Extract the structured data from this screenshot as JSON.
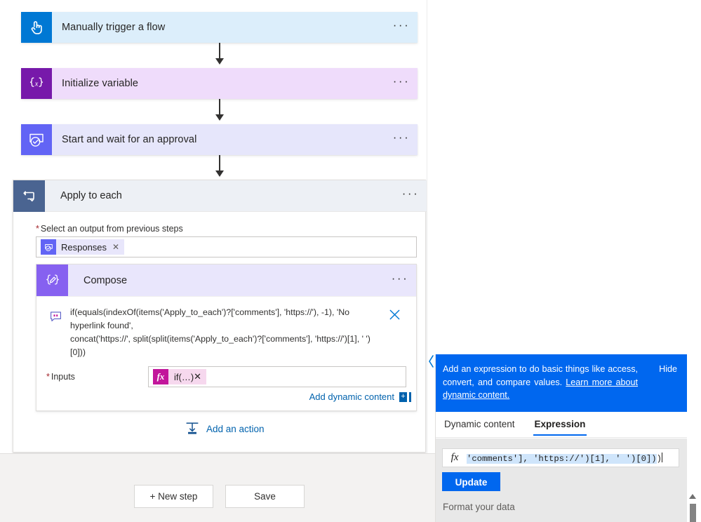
{
  "canvas": {
    "cards": [
      {
        "id": "trigger",
        "title": "Manually trigger a flow",
        "icon": "touch-tap-icon",
        "menu": "···"
      },
      {
        "id": "initvar",
        "title": "Initialize variable",
        "icon": "variable-braces-icon",
        "menu": "···"
      },
      {
        "id": "approval",
        "title": "Start and wait for an approval",
        "icon": "approval-check-icon",
        "menu": "···"
      }
    ],
    "scope": {
      "title": "Apply to each",
      "icon": "loop-repeat-icon",
      "menu": "···",
      "select_output_label": "Select an output from previous steps",
      "required_marker": "*",
      "output_token": {
        "label": "Responses",
        "icon": "approval-check-icon",
        "remove": "✕"
      },
      "compose": {
        "title": "Compose",
        "icon": "compose-pencil-icon",
        "menu": "···",
        "expression_line_1": "if(equals(indexOf(items('Apply_to_each')?['comments'], 'https://'), -1), 'No hyperlink found',",
        "expression_line_2": "concat('https://', split(split(items('Apply_to_each')?['comments'], 'https://')[1], ' ')[0]))",
        "expression_icon": "comment-bubble-icon",
        "expression_close_icon": "close-x-icon",
        "inputs_label": "Inputs",
        "inputs_token": {
          "fx": "fx",
          "label": "if(…)",
          "remove": "✕"
        },
        "add_dynamic_content": "Add dynamic content",
        "add_dynamic_plus": "+"
      }
    },
    "add_action": {
      "label": "Add an action",
      "icon": "add-action-icon"
    },
    "bottom_buttons": {
      "new_step": "+ New step",
      "save": "Save"
    }
  },
  "expression_panel": {
    "banner": {
      "text_before_link": "Add an expression to do basic things like access, convert, and compare values. ",
      "link_text": "Learn more about dynamic content.",
      "hide_label": "Hide"
    },
    "tabs": [
      {
        "label": "Dynamic content",
        "active": false
      },
      {
        "label": "Expression",
        "active": true
      }
    ],
    "editor": {
      "fx_glyph": "fx",
      "selected_text": "'comments'], 'https://')[1], ' ')[0])",
      "trailing_text": ")",
      "update_button": "Update"
    },
    "format_row": {
      "label": "Format your data"
    },
    "scrollbar": {
      "up_arrow_icon": "scroll-up-arrow-icon",
      "thumb_icon": "scroll-thumb"
    },
    "collapse_chevron_icon": "chevron-left-icon"
  },
  "colors": {
    "trigger_accent": "#0078d4",
    "trigger_bg": "#dceefb",
    "variable_accent": "#7719aa",
    "variable_bg": "#efdcfb",
    "approval_accent": "#6264f5",
    "approval_bg": "#e6e6fb",
    "scope_accent": "#4a6491",
    "scope_bg": "#edf0f5",
    "compose_accent": "#8661f0",
    "compose_bg": "#e9e6fc",
    "link": "#0062ad",
    "primary_blue": "#0067ef",
    "fx_magenta": "#c2169b",
    "required_red": "#a4262c",
    "selection_blue": "#cfe5fb"
  }
}
